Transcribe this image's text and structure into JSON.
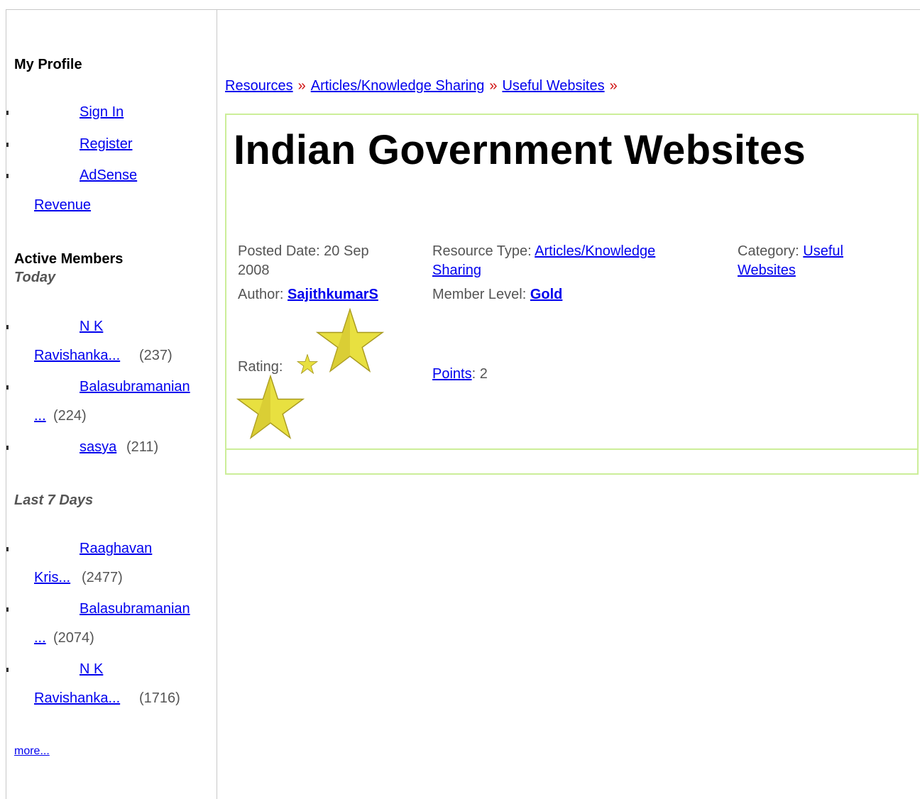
{
  "sidebar": {
    "profile_heading": "My Profile",
    "profile_links": [
      "Sign In",
      "Register",
      "AdSense",
      "Revenue"
    ],
    "active_heading": "Active Members",
    "today_label": "Today",
    "today": [
      {
        "name_line1": "N K",
        "name_line2": "Ravishanka...",
        "count": "(237)"
      },
      {
        "name_line1": "Balasubramanian",
        "name_line2": "...",
        "count": "(224)"
      },
      {
        "name_line1": "sasya",
        "count": "(211)"
      }
    ],
    "week_label": "Last 7 Days",
    "week": [
      {
        "name_line1": "Raaghavan",
        "name_line2": "Kris...",
        "count": "(2477)"
      },
      {
        "name_line1": "Balasubramanian",
        "name_line2": "...",
        "count": "(2074)"
      },
      {
        "name_line1": "N K",
        "name_line2": "Ravishanka...",
        "count": "(1716)"
      }
    ],
    "more_link": "more..."
  },
  "breadcrumb": {
    "items": [
      "Resources",
      "Articles/Knowledge Sharing",
      "Useful Websites"
    ],
    "separator": "»"
  },
  "article": {
    "title": "Indian Government Websites",
    "posted_label": "Posted Date: 20 Sep",
    "posted_year": "2008",
    "author_label": "Author:",
    "author": "SajithkumarS",
    "rating_label": "Rating:",
    "rating_icon": "star-icon",
    "resource_type_label": "Resource Type:",
    "resource_type_line1": "Articles/Knowledge",
    "resource_type_line2": "Sharing",
    "member_level_label": "Member Level:",
    "member_level": "Gold",
    "points_link": "Points",
    "points_value": ": 2",
    "category_label": "Category:",
    "category_line1": "Useful",
    "category_line2": "Websites"
  },
  "colors": {
    "link": "#0000ee",
    "separator": "#d01010",
    "box_border": "#ccee99",
    "star_fill": "#e8e040"
  }
}
